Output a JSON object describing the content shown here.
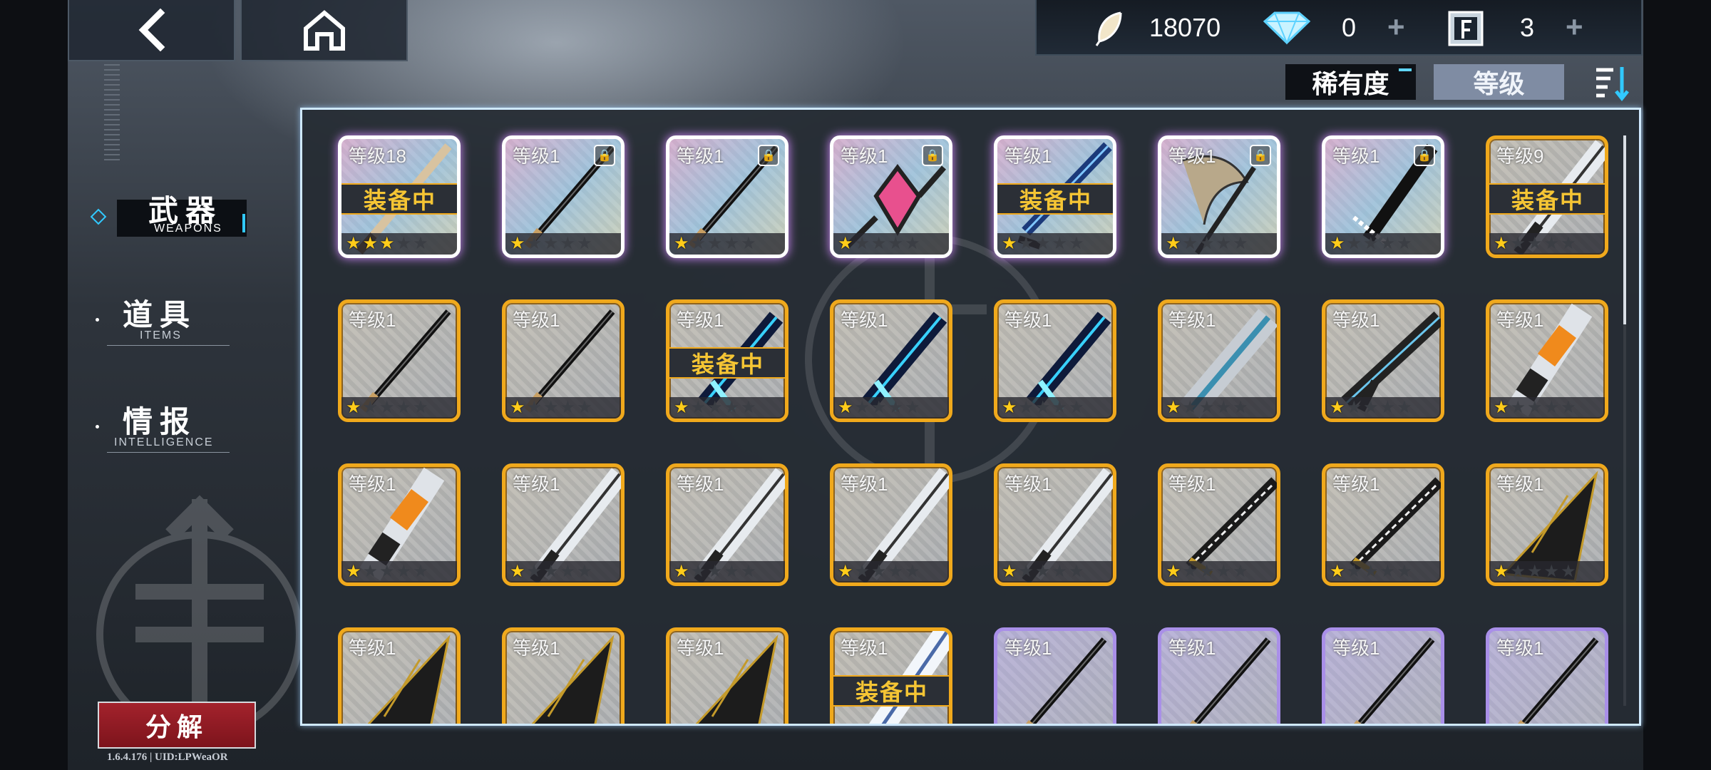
{
  "currencies": {
    "feather": "18070",
    "diamond": "0",
    "card": "3"
  },
  "sort": {
    "rarity_label": "稀有度",
    "level_label": "等级"
  },
  "menu": {
    "weapons_zh": "武器",
    "weapons_en": "WEAPONS",
    "items_zh": "道具",
    "items_en": "ITEMS",
    "intel_zh": "情报",
    "intel_en": "INTELLIGENCE"
  },
  "decompose_label": "分解",
  "version": "1.6.4.176 | UID:LPWeaOR",
  "equipped_label": "装备中",
  "cards": [
    {
      "level": "等级18",
      "stars": 3,
      "frame": "holo",
      "locked": false,
      "equipped": true,
      "weapon": "katana-wood"
    },
    {
      "level": "等级1",
      "stars": 1,
      "frame": "holo",
      "locked": true,
      "equipped": false,
      "weapon": "katana"
    },
    {
      "level": "等级1",
      "stars": 1,
      "frame": "holo",
      "locked": true,
      "equipped": false,
      "weapon": "katana"
    },
    {
      "level": "等级1",
      "stars": 1,
      "frame": "holo",
      "locked": true,
      "equipped": false,
      "weapon": "crystal-staff"
    },
    {
      "level": "等级1",
      "stars": 1,
      "frame": "holo",
      "locked": false,
      "equipped": true,
      "weapon": "blue-blade"
    },
    {
      "level": "等级1",
      "stars": 1,
      "frame": "holo",
      "locked": true,
      "equipped": false,
      "weapon": "scythe-hair"
    },
    {
      "level": "等级1",
      "stars": 1,
      "frame": "holo",
      "locked": true,
      "equipped": false,
      "weapon": "lace-blade"
    },
    {
      "level": "等级9",
      "stars": 1,
      "frame": "gold",
      "locked": false,
      "equipped": true,
      "weapon": "great-sword"
    },
    {
      "level": "等级1",
      "stars": 1,
      "frame": "gold",
      "locked": false,
      "equipped": false,
      "weapon": "katana"
    },
    {
      "level": "等级1",
      "stars": 1,
      "frame": "gold",
      "locked": false,
      "equipped": false,
      "weapon": "katana"
    },
    {
      "level": "等级1",
      "stars": 1,
      "frame": "gold",
      "locked": false,
      "equipped": true,
      "weapon": "energy-blade"
    },
    {
      "level": "等级1",
      "stars": 1,
      "frame": "gold",
      "locked": false,
      "equipped": false,
      "weapon": "energy-blade"
    },
    {
      "level": "等级1",
      "stars": 1,
      "frame": "gold",
      "locked": false,
      "equipped": false,
      "weapon": "energy-blade"
    },
    {
      "level": "等级1",
      "stars": 1,
      "frame": "gold",
      "locked": false,
      "equipped": false,
      "weapon": "cannon"
    },
    {
      "level": "等级1",
      "stars": 1,
      "frame": "gold",
      "locked": false,
      "equipped": false,
      "weapon": "rifle"
    },
    {
      "level": "等级1",
      "stars": 1,
      "frame": "gold",
      "locked": false,
      "equipped": false,
      "weapon": "orange-cannon"
    },
    {
      "level": "等级1",
      "stars": 1,
      "frame": "gold",
      "locked": false,
      "equipped": false,
      "weapon": "orange-cannon"
    },
    {
      "level": "等级1",
      "stars": 1,
      "frame": "gold",
      "locked": false,
      "equipped": false,
      "weapon": "great-sword"
    },
    {
      "level": "等级1",
      "stars": 1,
      "frame": "gold",
      "locked": false,
      "equipped": false,
      "weapon": "great-sword"
    },
    {
      "level": "等级1",
      "stars": 1,
      "frame": "gold",
      "locked": false,
      "equipped": false,
      "weapon": "great-sword"
    },
    {
      "level": "等级1",
      "stars": 1,
      "frame": "gold",
      "locked": false,
      "equipped": false,
      "weapon": "great-sword"
    },
    {
      "level": "等级1",
      "stars": 1,
      "frame": "gold",
      "locked": false,
      "equipped": false,
      "weapon": "saw-blade"
    },
    {
      "level": "等级1",
      "stars": 1,
      "frame": "gold",
      "locked": false,
      "equipped": false,
      "weapon": "saw-blade"
    },
    {
      "level": "等级1",
      "stars": 1,
      "frame": "gold",
      "locked": false,
      "equipped": false,
      "weapon": "gauntlet"
    },
    {
      "level": "等级1",
      "stars": 1,
      "frame": "gold",
      "locked": false,
      "equipped": false,
      "weapon": "gauntlet"
    },
    {
      "level": "等级1",
      "stars": 1,
      "frame": "gold",
      "locked": false,
      "equipped": false,
      "weapon": "gauntlet"
    },
    {
      "level": "等级1",
      "stars": 1,
      "frame": "gold",
      "locked": false,
      "equipped": false,
      "weapon": "gauntlet"
    },
    {
      "level": "等级1",
      "stars": 1,
      "frame": "gold",
      "locked": false,
      "equipped": true,
      "weapon": "white-blade"
    },
    {
      "level": "等级1",
      "stars": 1,
      "frame": "purple",
      "locked": false,
      "equipped": false,
      "weapon": "katana"
    },
    {
      "level": "等级1",
      "stars": 1,
      "frame": "purple",
      "locked": false,
      "equipped": false,
      "weapon": "katana"
    },
    {
      "level": "等级1",
      "stars": 1,
      "frame": "purple",
      "locked": false,
      "equipped": false,
      "weapon": "katana"
    },
    {
      "level": "等级1",
      "stars": 1,
      "frame": "purple",
      "locked": false,
      "equipped": false,
      "weapon": "katana"
    }
  ],
  "colors": {
    "accent_cyan": "#31c9ff",
    "gold_frame": "#f0a91c",
    "equipped_text": "#f5c534",
    "decompose_red": "#a3222c"
  }
}
